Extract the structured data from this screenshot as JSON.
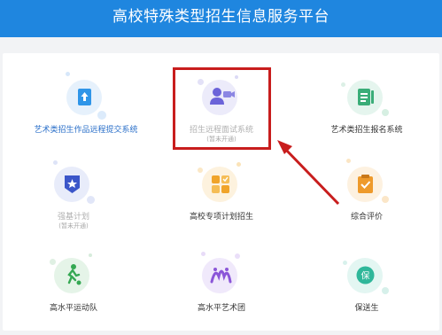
{
  "header": {
    "title": "高校特殊类型招生信息服务平台"
  },
  "tiles": [
    {
      "label": "艺术类招生作品远程提交系统",
      "sub": "",
      "icon": "upload-document-icon",
      "color": "#2f95e8",
      "bg": "#e6f1fc",
      "state": "link"
    },
    {
      "label": "招生远程面试系统",
      "sub": "(暂未开通)",
      "icon": "video-interview-icon",
      "color": "#6b63d9",
      "bg": "#ecebfa",
      "state": "dim"
    },
    {
      "label": "艺术类招生报名系统",
      "sub": "",
      "icon": "form-document-icon",
      "color": "#3aad78",
      "bg": "#e5f5ee",
      "state": "normal"
    },
    {
      "label": "强基计划",
      "sub": "(暂未开通)",
      "icon": "shield-badge-icon",
      "color": "#3b56c9",
      "bg": "#e8ecfa",
      "state": "dim"
    },
    {
      "label": "高校专项计划招生",
      "sub": "",
      "icon": "grid-apps-icon",
      "color": "#f0a42a",
      "bg": "#fdf2de",
      "state": "normal"
    },
    {
      "label": "综合评价",
      "sub": "",
      "icon": "clipboard-check-icon",
      "color": "#ee9a2b",
      "bg": "#fdf1e0",
      "state": "normal"
    },
    {
      "label": "高水平运动队",
      "sub": "",
      "icon": "soccer-player-icon",
      "color": "#35a853",
      "bg": "#e5f4e8",
      "state": "normal"
    },
    {
      "label": "高水平艺术团",
      "sub": "",
      "icon": "art-troupe-icon",
      "color": "#8b56d8",
      "bg": "#f0e9fb",
      "state": "normal"
    },
    {
      "label": "保送生",
      "sub": "",
      "icon": "guarantee-badge-icon",
      "color": "#2fb79a",
      "bg": "#e3f6f2",
      "state": "normal"
    }
  ]
}
